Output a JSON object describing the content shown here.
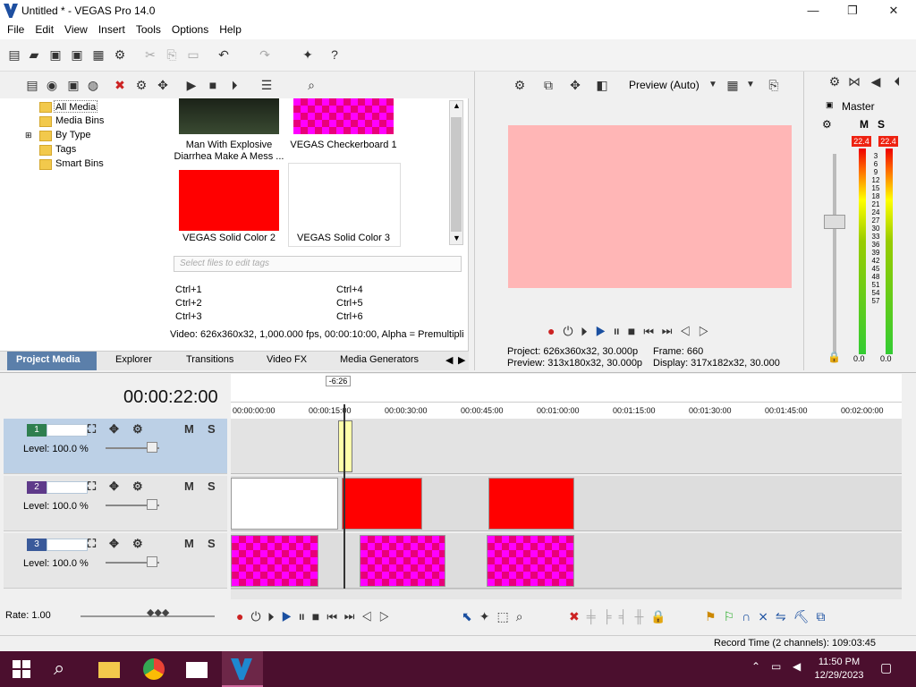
{
  "window": {
    "title": "Untitled * - VEGAS Pro 14.0",
    "minimize": "—",
    "maximize": "❐",
    "close": "✕"
  },
  "menu": [
    "File",
    "Edit",
    "View",
    "Insert",
    "Tools",
    "Options",
    "Help"
  ],
  "tree": [
    "All Media",
    "Media Bins",
    "By Type",
    "Tags",
    "Smart Bins"
  ],
  "thumbs": [
    {
      "label": "Man With Explosive Diarrhea Make A Mess ..."
    },
    {
      "label": "VEGAS Checkerboard 1"
    },
    {
      "label": "VEGAS Solid Color 2"
    },
    {
      "label": "VEGAS Solid Color 3"
    }
  ],
  "tags": {
    "placeholder": "Select files to edit tags"
  },
  "shortcuts": [
    "Ctrl+1",
    "Ctrl+2",
    "Ctrl+3",
    "Ctrl+4",
    "Ctrl+5",
    "Ctrl+6"
  ],
  "media_info": "Video: 626x360x32, 1,000.000 fps, 00:00:10:00, Alpha = Premultipli",
  "media_tabs": [
    "Project Media",
    "Explorer",
    "Transitions",
    "Video FX",
    "Media Generators"
  ],
  "preview": {
    "mode": "Preview (Auto)",
    "project": "Project:  626x360x32, 30.000p",
    "preview": "Preview: 313x180x32, 30.000p",
    "frame": "Frame:   660",
    "display": "Display:  317x182x32, 30.000"
  },
  "master": {
    "title": "Master",
    "peak_left": "22.4",
    "peak_right": "22.4",
    "scale": [
      "3",
      "6",
      "9",
      "12",
      "15",
      "18",
      "21",
      "24",
      "27",
      "30",
      "33",
      "36",
      "39",
      "42",
      "45",
      "48",
      "51",
      "54",
      "57"
    ],
    "bottom_left": "0.0",
    "bottom_right": "0.0"
  },
  "timeline": {
    "timecode": "00:00:22:00",
    "marker": "-6:26",
    "ruler": [
      "00:00:00:00",
      "00:00:15:00",
      "00:00:30:00",
      "00:00:45:00",
      "00:01:00:00",
      "00:01:15:00",
      "00:01:30:00",
      "00:01:45:00",
      "00:02:00:00"
    ]
  },
  "tracks": [
    {
      "num": "1",
      "level": "Level: 100.0 %",
      "color": "#2f7f4f"
    },
    {
      "num": "2",
      "level": "Level: 100.0 %",
      "color": "#5e3a8a"
    },
    {
      "num": "3",
      "level": "Level: 100.0 %",
      "color": "#3a5a9a"
    }
  ],
  "rate": "Rate: 1.00",
  "status": "Record Time (2 channels): 109:03:45",
  "clock": {
    "time": "11:50 PM",
    "date": "12/29/2023"
  }
}
